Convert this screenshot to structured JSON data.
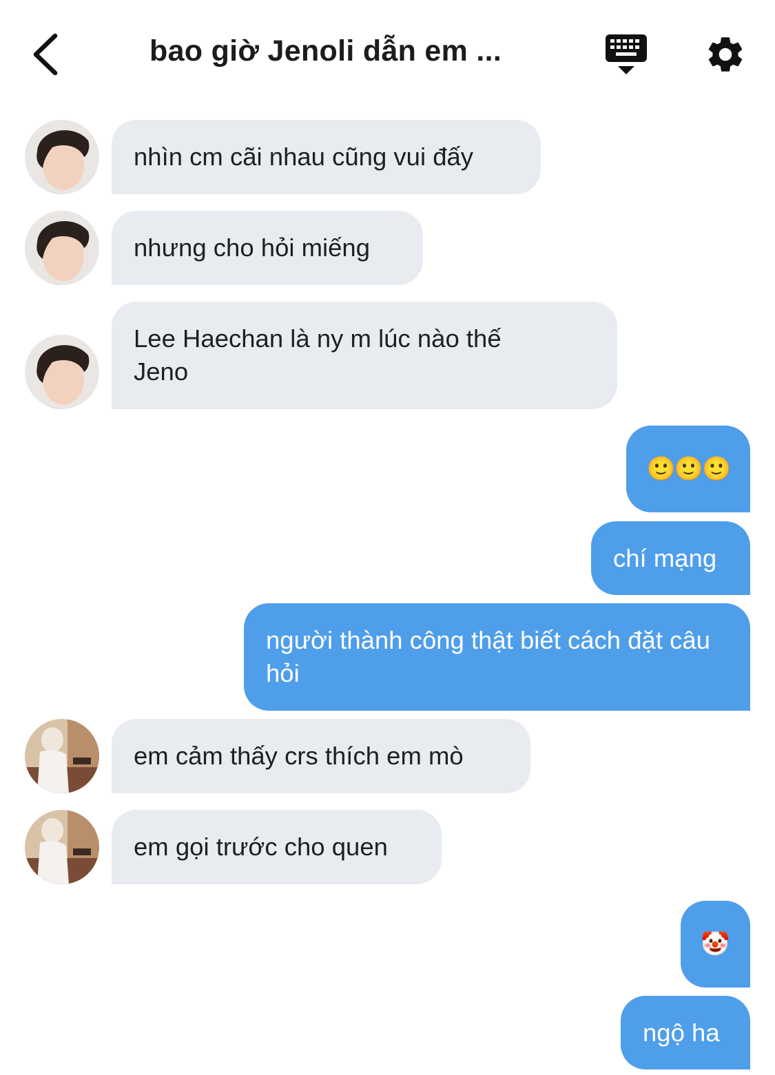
{
  "header": {
    "title": "bao giờ Jenoli dẫn em ...",
    "back_icon": "chevron-left-icon",
    "keyboard_icon": "keyboard-icon",
    "settings_icon": "gear-icon"
  },
  "messages": [
    {
      "side": "in",
      "text": "nhìn cm cãi nhau cũng vui đấy",
      "avatar": "avatar-a"
    },
    {
      "side": "in",
      "text": "nhưng cho hỏi miếng",
      "avatar": "avatar-a"
    },
    {
      "side": "in",
      "text": "Lee Haechan là ny m lúc nào thế Jeno",
      "avatar": "avatar-a"
    },
    {
      "side": "out",
      "text": "🙂🙂🙂"
    },
    {
      "side": "out",
      "text": "chí mạng"
    },
    {
      "side": "out",
      "text": "người thành công thật biết cách đặt câu hỏi"
    },
    {
      "side": "in",
      "text": "em cảm thấy crs thích em mò",
      "avatar": "avatar-b"
    },
    {
      "side": "in",
      "text": "em gọi trước cho quen",
      "avatar": "avatar-b"
    },
    {
      "side": "out",
      "text": "🤡"
    },
    {
      "side": "out",
      "text": "ngộ ha"
    }
  ],
  "colors": {
    "incoming_bubble": "#e8ebef",
    "outgoing_bubble": "#4f9eea",
    "text_dark": "#1f1f1f",
    "background": "#ffffff"
  }
}
